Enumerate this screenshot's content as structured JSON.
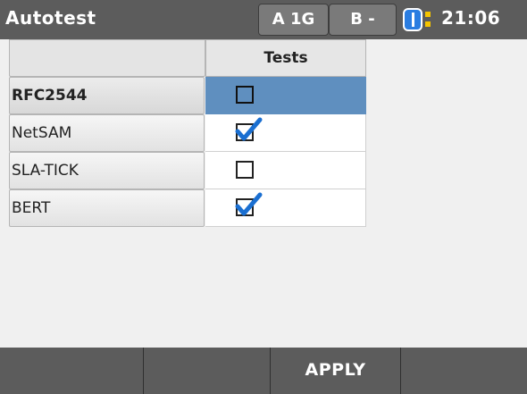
{
  "header": {
    "title": "Autotest",
    "port_a": "A 1G",
    "port_b": "B -",
    "time": "21:06"
  },
  "table": {
    "column_header": "Tests",
    "rows": [
      {
        "label": "RFC2544",
        "checked": false,
        "selected": true
      },
      {
        "label": "NetSAM",
        "checked": true,
        "selected": false
      },
      {
        "label": "SLA-TICK",
        "checked": false,
        "selected": false
      },
      {
        "label": "BERT",
        "checked": true,
        "selected": false
      }
    ]
  },
  "softkeys": [
    "",
    "",
    "APPLY",
    ""
  ],
  "colors": {
    "bar": "#5c5c5c",
    "selection": "#5f8fbf",
    "check": "#1a6fd1",
    "battery": "#2a7de1",
    "plug": "#f5c400"
  },
  "icons": {
    "battery": "battery-icon",
    "power": "power-plug-icon",
    "checkmark": "checkmark-icon"
  }
}
